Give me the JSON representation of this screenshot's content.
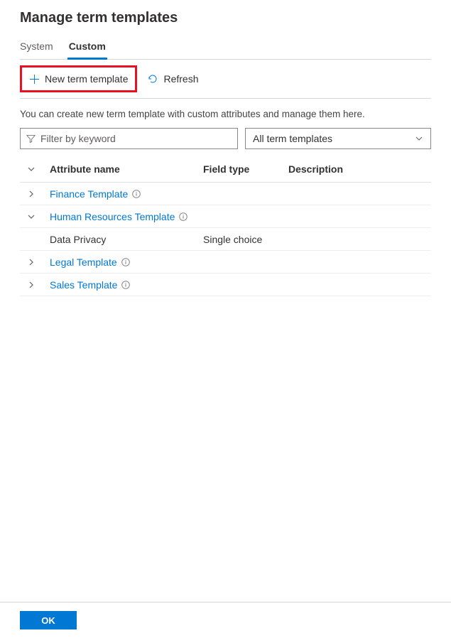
{
  "title": "Manage term templates",
  "tabs": {
    "system": "System",
    "custom": "Custom"
  },
  "toolbar": {
    "new_template": "New term template",
    "refresh": "Refresh"
  },
  "description": "You can create new term template with custom attributes and manage them here.",
  "filter": {
    "placeholder": "Filter by keyword",
    "dropdown_label": "All term templates"
  },
  "columns": {
    "name": "Attribute name",
    "type": "Field type",
    "desc": "Description"
  },
  "templates": [
    {
      "name": "Finance Template",
      "expanded": false
    },
    {
      "name": "Human Resources Template",
      "expanded": true,
      "children": [
        {
          "name": "Data Privacy",
          "type": "Single choice"
        }
      ]
    },
    {
      "name": "Legal Template",
      "expanded": false
    },
    {
      "name": "Sales Template",
      "expanded": false
    }
  ],
  "footer": {
    "ok": "OK"
  }
}
